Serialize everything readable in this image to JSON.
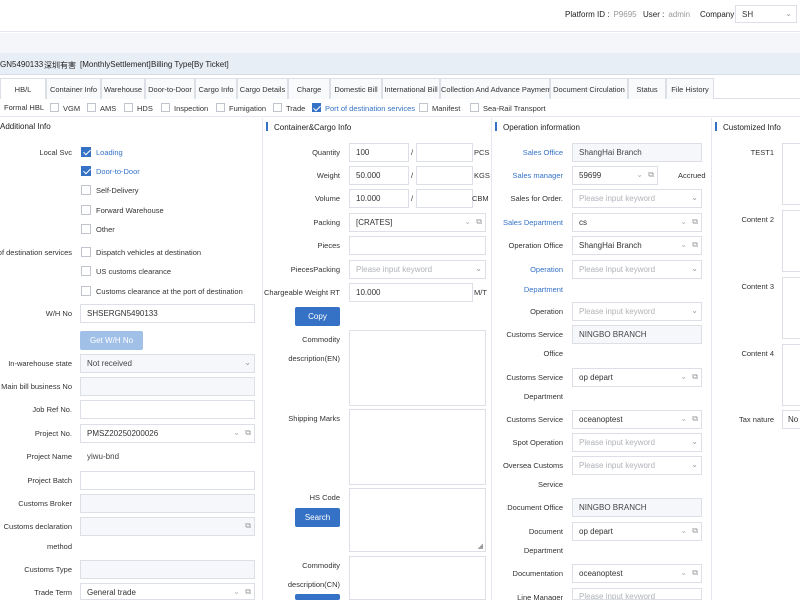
{
  "topbar": {
    "platform_label": "Platform ID :",
    "platform_value": "P9695",
    "user_label": "User :",
    "user_value": "admin",
    "company_label": "Company :",
    "company_value": "SH"
  },
  "bill": {
    "number": "GN5490133",
    "customer": "深圳有害",
    "settlement": "[MonthlySettlement]",
    "billing_type": "Billing Type[By Ticket]"
  },
  "tabs": [
    "HB/L",
    "Container Info",
    "Warehouse",
    "Door-to-Door",
    "Cargo Info",
    "Cargo Details",
    "Charge",
    "Domestic Bill",
    "International Bill",
    "Collection And Advance Payment",
    "Document Circulation",
    "Status",
    "File History"
  ],
  "services": [
    {
      "label": "Formal HBL",
      "checked": false
    },
    {
      "label": "VGM",
      "checked": false
    },
    {
      "label": "AMS",
      "checked": false
    },
    {
      "label": "HDS",
      "checked": false
    },
    {
      "label": "Inspection",
      "checked": false
    },
    {
      "label": "Fumigation",
      "checked": false
    },
    {
      "label": "Trade",
      "checked": false
    },
    {
      "label": "Port of destination services",
      "checked": true
    },
    {
      "label": "Manifest",
      "checked": false
    },
    {
      "label": "Sea-Rail Transport",
      "checked": false
    }
  ],
  "additional": {
    "title": "Additional Info",
    "local_svc_label": "Local Svc",
    "local_options": [
      {
        "label": "Loading",
        "checked": true
      },
      {
        "label": "Door-to-Door",
        "checked": true
      },
      {
        "label": "Self-Delivery",
        "checked": false
      },
      {
        "label": "Forward Warehouse",
        "checked": false
      },
      {
        "label": "Other",
        "checked": false
      }
    ],
    "dest_label": "ort of destination services",
    "dest_options": [
      {
        "label": "Dispatch vehicles at destination",
        "checked": false
      },
      {
        "label": "US customs clearance",
        "checked": false
      },
      {
        "label": "Customs clearance at the port of destination",
        "checked": false
      }
    ],
    "wh_no_label": "W/H No",
    "wh_no_value": "SHSERGN5490133",
    "get_wh_button": "Get W/H No",
    "inwarehouse_label": "In-warehouse state",
    "inwarehouse_value": "Not received",
    "main_bill_label": "Main bill business No",
    "job_ref_label": "Job Ref No.",
    "project_no_label": "Project No.",
    "project_no_value": "PMSZ20250200026",
    "project_name_label": "Project Name",
    "project_name_value": "yiwu-bnd",
    "project_batch_label": "Project Batch",
    "customs_broker_label": "Customs Broker",
    "customs_decl_label_1": "Customs declaration",
    "customs_decl_label_2": "method",
    "customs_type_label": "Customs Type",
    "trade_term_label": "Trade Term",
    "trade_term_value": "General trade"
  },
  "container": {
    "title": "Container&Cargo Info",
    "quantity_label": "Quantity",
    "quantity_value": "100",
    "quantity_unit": "PCS",
    "weight_label": "Weight",
    "weight_value": "50.000",
    "weight_unit": "KGS",
    "volume_label": "Volume",
    "volume_value": "10.000",
    "volume_unit": "CBM",
    "slash": "/",
    "packing_label": "Packing",
    "packing_value": "[CRATES]",
    "pieces_label": "Pieces",
    "pieces_packing_label": "PiecesPacking",
    "pieces_packing_placeholder": "Please input keyword",
    "chargeable_label": "Chargeable Weight RT",
    "chargeable_value": "10.000",
    "chargeable_unit": "M/T",
    "copy_button": "Copy",
    "commodity_en_label_1": "Commodity",
    "commodity_en_label_2": "description(EN)",
    "shipping_marks_label": "Shipping Marks",
    "hs_code_label": "HS Code",
    "search_button": "Search",
    "commodity_cn_label_1": "Commodity",
    "commodity_cn_label_2": "description(CN)"
  },
  "operation": {
    "title": "Operation information",
    "sales_office_label": "Sales Office",
    "sales_office_value": "ShangHai Branch",
    "sales_manager_label": "Sales manager",
    "sales_manager_value": "59699",
    "accrued_label": "Accrued",
    "sales_for_order_label": "Sales for Order.",
    "sales_for_order_placeholder": "Please input keyword",
    "sales_dept_label": "Sales Department",
    "sales_dept_value": "cs",
    "operation_office_label": "Operation Office",
    "operation_office_value": "ShangHai Branch",
    "operation_dept_label_1": "Operation",
    "operation_dept_label_2": "Department",
    "operation_dept_placeholder": "Please input keyword",
    "operation_label": "Operation",
    "operation_placeholder": "Please input keyword",
    "customs_service_office_label_1": "Customs Service",
    "customs_service_office_label_2": "Office",
    "customs_service_office_value": "NINGBO BRANCH",
    "customs_service_dept_label_1": "Customs Service",
    "customs_service_dept_label_2": "Department",
    "customs_service_dept_value": "op depart",
    "customs_service_label": "Customs Service",
    "customs_service_value": "oceanoptest",
    "spot_operation_label": "Spot Operation",
    "spot_operation_placeholder": "Please input keyword",
    "oversea_customs_label_1": "Oversea Customs",
    "oversea_customs_label_2": "Service",
    "oversea_customs_placeholder": "Please input keyword",
    "document_office_label": "Document Office",
    "document_office_value": "NINGBO BRANCH",
    "document_dept_label_1": "Document",
    "document_dept_label_2": "Department",
    "document_dept_value": "op depart",
    "documentation_label": "Documentation",
    "documentation_value": "oceanoptest",
    "line_manager_label": "Line Manager",
    "line_manager_placeholder": "Please input keyword"
  },
  "customized": {
    "title": "Customized Info",
    "test1_label": "TEST1",
    "content2_label": "Content 2",
    "content3_label": "Content 3",
    "content4_label": "Content 4",
    "tax_nature_label": "Tax nature",
    "tax_nature_value": "No"
  },
  "icons": {
    "dropdown": "chevron-down-icon",
    "copy": "copy-icon"
  },
  "colors": {
    "accent": "#3572c6",
    "bill_band": "#e8eef6"
  }
}
